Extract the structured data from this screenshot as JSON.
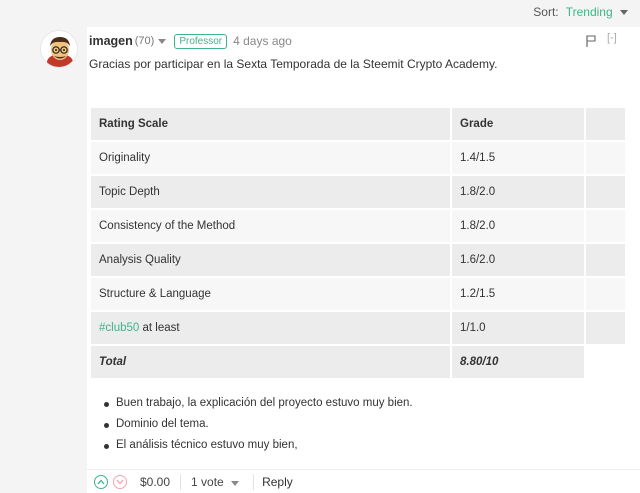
{
  "sort": {
    "label": "Sort:",
    "value": "Trending"
  },
  "comment": {
    "author": "imagen",
    "reputation": "(70)",
    "badge": "Professor",
    "time": "4 days ago",
    "collapse": "[-]",
    "text": "Gracias por participar en la Sexta Temporada de la Steemit Crypto Academy."
  },
  "table": {
    "headers": [
      "Rating Scale",
      "Grade"
    ],
    "rows": [
      {
        "label": "Originality",
        "grade": "1.4/1.5"
      },
      {
        "label": "Topic Depth",
        "grade": "1.8/2.0"
      },
      {
        "label": "Consistency of the Method",
        "grade": "1.8/2.0"
      },
      {
        "label": "Analysis Quality",
        "grade": "1.6/2.0"
      },
      {
        "label": "Structure & Language",
        "grade": "1.2/1.5"
      },
      {
        "tag": "#club50",
        "label": " at least",
        "grade": "1/1.0"
      }
    ],
    "total": {
      "label": "Total",
      "grade": "8.80/10"
    }
  },
  "notes": [
    "Buen trabajo, la explicación del proyecto estuvo muy bien.",
    "Dominio del tema.",
    "El análisis técnico estuvo muy bien,"
  ],
  "footer": {
    "payout": "$0.00",
    "votes": "1 vote",
    "reply": "Reply"
  }
}
